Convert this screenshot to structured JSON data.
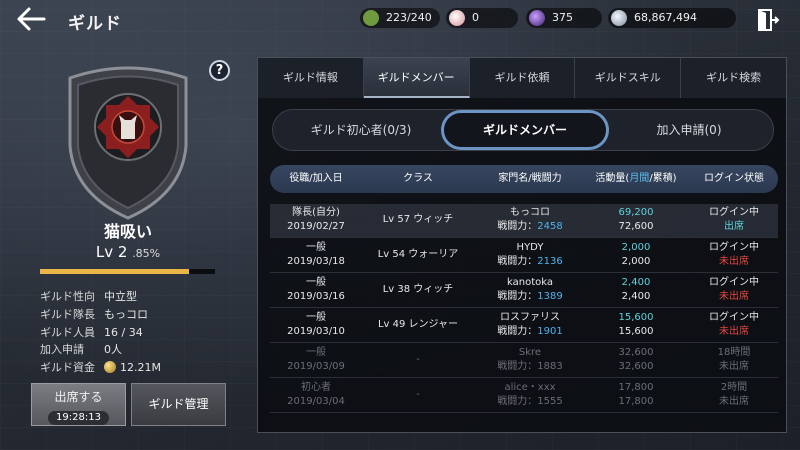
{
  "header": {
    "title": "ギルド",
    "back_icon": "arrow-left-icon",
    "exit_icon": "exit-door-icon"
  },
  "resources": [
    {
      "icon": "stamina-icon",
      "value": "223/240",
      "color": "#9bd26a"
    },
    {
      "icon": "pearl-icon",
      "value": "0",
      "color": "#e9c9c9"
    },
    {
      "icon": "orb-icon",
      "value": "375",
      "color": "#8a5ad0"
    },
    {
      "icon": "silver-coin-icon",
      "value": "68,867,494",
      "color": "#cfd8e2"
    }
  ],
  "guild": {
    "name": "猫吸い",
    "level_text": "Lv 2",
    "level_pct": ".85%",
    "xp_fraction": 0.85,
    "info": [
      {
        "key": "ギルド性向",
        "value": "中立型"
      },
      {
        "key": "ギルド隊長",
        "value": "もっコロ"
      },
      {
        "key": "ギルド人員",
        "value": "16 / 34"
      },
      {
        "key": "加入申請",
        "value": "0人"
      },
      {
        "key": "ギルド資金",
        "value": "12.21M"
      }
    ],
    "attend_label": "出席する",
    "attend_timer": "19:28:13",
    "manage_label": "ギルド管理"
  },
  "tabs": [
    "ギルド情報",
    "ギルドメンバー",
    "ギルド依頼",
    "ギルドスキル",
    "ギルド検索"
  ],
  "active_tab": 1,
  "subtabs": [
    "ギルド初心者(0/3)",
    "ギルドメンバー",
    "加入申請(0)"
  ],
  "active_subtab": 1,
  "table": {
    "headers": {
      "role": "役職/加入日",
      "class": "クラス",
      "family": "家門名/戦闘力",
      "activity_pre": "活動量(",
      "activity_hl": "月間",
      "activity_post": "/累積)",
      "login": "ログイン状態"
    },
    "rows": [
      {
        "role": "隊長(自分)",
        "date": "2019/02/27",
        "cls": "Lv 57 ウィッチ",
        "name": "もっコロ",
        "power_label": "戦闘力：",
        "power": "2458",
        "monthly": "69,200",
        "total": "72,600",
        "login": "ログイン中",
        "status": "出席",
        "status_color": "cyan",
        "self": true,
        "online": true
      },
      {
        "role": "一般",
        "date": "2019/03/18",
        "cls": "Lv 54 ウォーリア",
        "name": "HYDY",
        "power_label": "戦闘力：",
        "power": "2136",
        "monthly": "2,000",
        "total": "2,000",
        "login": "ログイン中",
        "status": "未出席",
        "status_color": "red",
        "self": false,
        "online": true
      },
      {
        "role": "一般",
        "date": "2019/03/16",
        "cls": "Lv 38 ウィッチ",
        "name": "kanotoka",
        "power_label": "戦闘力：",
        "power": "1389",
        "monthly": "2,400",
        "total": "2,400",
        "login": "ログイン中",
        "status": "未出席",
        "status_color": "red",
        "self": false,
        "online": true
      },
      {
        "role": "一般",
        "date": "2019/03/10",
        "cls": "Lv 49 レンジャー",
        "name": "ロスファリス",
        "power_label": "戦闘力：",
        "power": "1901",
        "monthly": "15,600",
        "total": "15,600",
        "login": "ログイン中",
        "status": "未出席",
        "status_color": "red",
        "self": false,
        "online": true
      },
      {
        "role": "一般",
        "date": "2019/03/09",
        "cls": "-",
        "name": "Skre",
        "power_label": "戦闘力：",
        "power": "1883",
        "monthly": "32,600",
        "total": "32,600",
        "login": "18時間",
        "status": "未出席",
        "status_color": "gray",
        "self": false,
        "online": false
      },
      {
        "role": "初心者",
        "date": "2019/03/04",
        "cls": "-",
        "name": "alice・xxx",
        "power_label": "戦闘力：",
        "power": "1555",
        "monthly": "17,800",
        "total": "17,800",
        "login": "2時間",
        "status": "未出席",
        "status_color": "gray",
        "self": false,
        "online": false
      }
    ]
  }
}
